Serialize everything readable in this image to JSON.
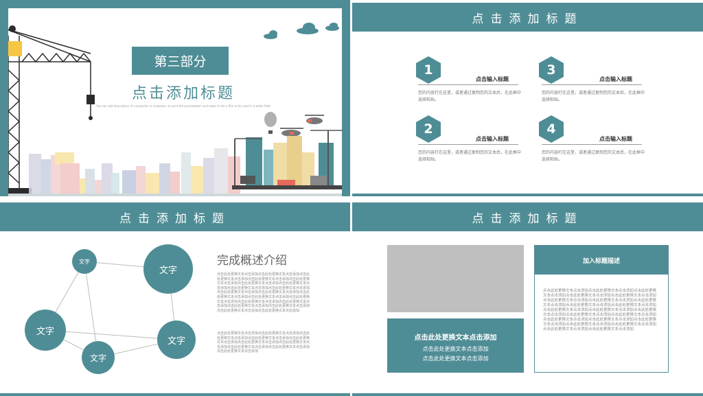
{
  "colors": {
    "accent": "#4f8d96",
    "gray_box": "#bfbfbf"
  },
  "slide1": {
    "label": "第三部分",
    "title": "点击添加标题",
    "tiny_text": "You can add description of a projector or computer, or print the presentation and make it into a film to be used in a wider field"
  },
  "slide2": {
    "header": "点击添加标题",
    "items": [
      {
        "number": "1",
        "title": "点击输入标题",
        "text": "您的内容打在这里，或者通过复制您的文本后，在此框中选择粘贴。"
      },
      {
        "number": "3",
        "title": "点击输入标题",
        "text": "您的内容打在这里，或者通过复制您的文本后，在此框中选择粘贴。"
      },
      {
        "number": "2",
        "title": "点击输入标题",
        "text": "您的内容打在这里，或者通过复制您的文本后，在此框中选择粘贴。"
      },
      {
        "number": "4",
        "title": "点击输入标题",
        "text": "您的内容打在这里，或者通过复制您的文本后，在此框中选择粘贴。"
      }
    ]
  },
  "slide3": {
    "header": "点击添加标题",
    "bubbles": [
      "文字",
      "文字",
      "文字",
      "文字",
      "文字"
    ],
    "heading": "完成概述介绍",
    "para1": "点击此处更换文本点击添加点击此处更换文本点击添加点击此处更换文本点击添加点击此处更换文本点击添加点击此处更换文本点击添加点击此处更换文本点击添加点击此处更换文本点击添加点击此处更换文本点击添加点击此处更换文本点击添加点击此处更换文本点击添加点击此处更换文本点击添加点击此处更换文本点击添加点击此处更换文本点击添加点击此处更换文本点击添加点击此处更换文本点击添加点击此处更换文本点击添加点击此处更换文本点击添加点击此处更换文本点击添加点击此处更换文本点击添加点击此处更换文本点击添加",
    "para2": "点击此处更换文本点击添加点击此处更换文本点击添加点击此处更换文本点击添加点击此处更换文本点击添加点击此处更换文本点击添加点击此处更换文本点击添加点击此处更换文本点击添加点击此处更换文本点击添加点击此处更换文本点击添加点击此处更换文本点击添加"
  },
  "slide4": {
    "header": "点击添加标题",
    "caption_title": "点击此处更换文本点击添加",
    "caption_line1": "点击此处更换文本点击添加",
    "caption_line2": "点击此处更换文本点击添加",
    "desc_title": "加入标题描述",
    "desc_text": "点击此处更换文本点击添加点击此处更换文本点击添加点击此处更换文本点击添加点击此处更换文本点击添加点击此处更换文本点击添加点击此处更换文本点击添加点击此处更换文本点击添加点击此处更换文本点击添加点击此处更换文本点击添加点击此处更换文本点击添加点击此处更换文本点击添加点击此处更换文本点击添加点击此处更换文本点击添加点击此处更换文本点击添加点击此处更换文本点击添加点击此处更换文本点击添加点击此处更换文本点击添加点击此处更换文本点击添加点击此处更换文本点击添加点击此处更换文本点击添加点击此处更换文本点击添加点击此处更换文本点击添加"
  }
}
